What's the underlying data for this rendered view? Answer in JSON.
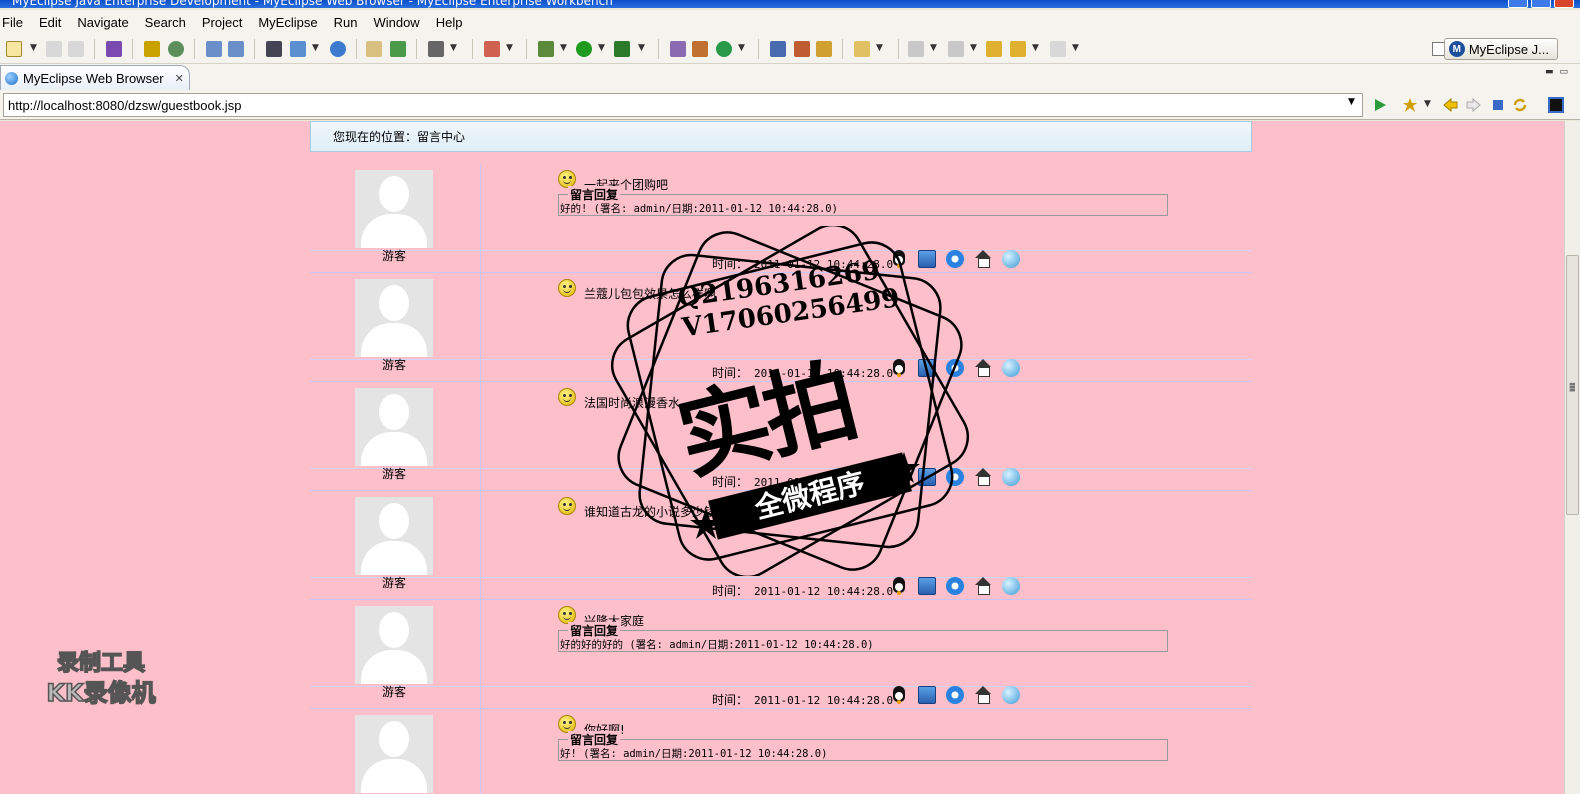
{
  "window": {
    "title": "MyEclipse Java Enterprise Development - MyEclipse Web Browser - MyEclipse Enterprise Workbench"
  },
  "menu": [
    "File",
    "Edit",
    "Navigate",
    "Search",
    "Project",
    "MyEclipse",
    "Run",
    "Window",
    "Help"
  ],
  "toolbar": {
    "perspective_label": "MyEclipse J..."
  },
  "editor_tab": {
    "label": "MyEclipse Web Browser"
  },
  "address_bar": {
    "url": "http://localhost:8080/dzsw/guestbook.jsp"
  },
  "page": {
    "breadcrumb": "您现在的位置：留言中心",
    "reply_legend": "留言回复",
    "time_label": "时间：",
    "entries": [
      {
        "user": "游客",
        "title": "一起来个团购吧",
        "reply": "好的! (署名: admin/日期:2011-01-12 10:44:28.0)",
        "time": "2011-01-12 10:44:28.0"
      },
      {
        "user": "游客",
        "title": "兰蔻儿包包效果怎么样啊",
        "reply": "",
        "time": "2011-01-12 10:44:28.0"
      },
      {
        "user": "游客",
        "title": "法国时尚浪漫香水",
        "reply": "",
        "time": "2011-01-12 10:44:28.0"
      },
      {
        "user": "游客",
        "title": "谁知道古龙的小说多少钱一套",
        "reply": "",
        "time": "2011-01-12 10:44:28.0"
      },
      {
        "user": "游客",
        "title": "兴隆大家庭",
        "reply": "好的好的好的 (署名: admin/日期:2011-01-12 10:44:28.0)",
        "time": "2011-01-12 10:44:28.0"
      },
      {
        "user": "游客",
        "title": "你好啊!",
        "reply": "好! (署名: admin/日期:2011-01-12 10:44:28.0)",
        "time": ""
      }
    ]
  },
  "watermarks": {
    "stamp_line1": "Q2196316269",
    "stamp_line2": "V17060256499",
    "stamp_main": "实拍",
    "stamp_banner": "全微程序",
    "recorder_line1": "录制工具",
    "recorder_line2": "KK录像机"
  },
  "colors": {
    "page_bg": "#fdc0cb",
    "breadcrumb_bg": "#e6f2f8",
    "divider": "#c9c6ff"
  }
}
